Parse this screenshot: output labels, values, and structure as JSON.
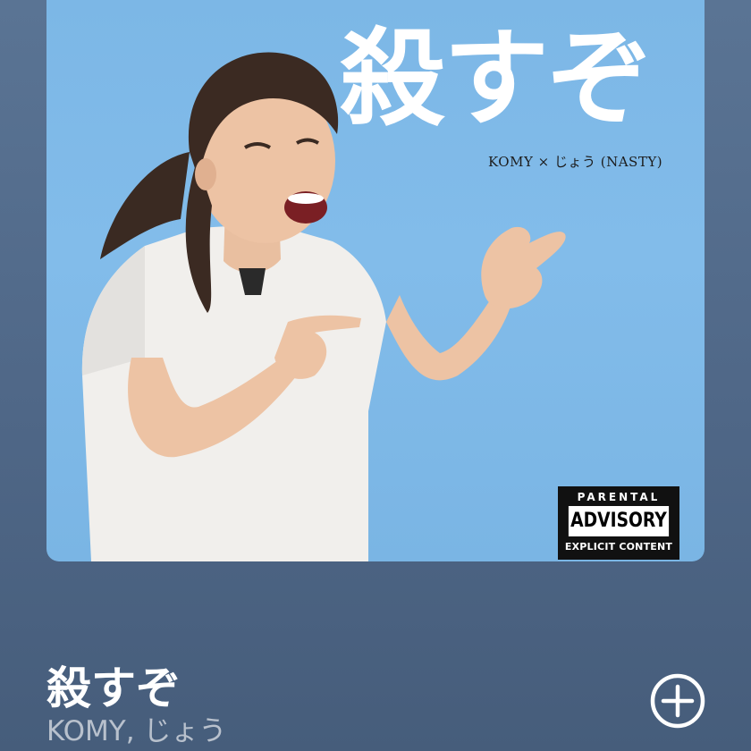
{
  "cover": {
    "title": "殺すぞ",
    "credit": "KOMY × じょう (NASTY)",
    "advisory": {
      "top": "PARENTAL",
      "middle": "ADVISORY",
      "bottom": "EXPLICIT CONTENT"
    }
  },
  "track": {
    "title": "殺すぞ",
    "artists": "KOMY, じょう"
  },
  "actions": {
    "add_icon": "plus-circle-icon"
  },
  "colors": {
    "background": "#4f6787",
    "cover_sky": "#7cb7e6",
    "title_text": "#ffffff",
    "artist_text": "#c4ccd8"
  }
}
